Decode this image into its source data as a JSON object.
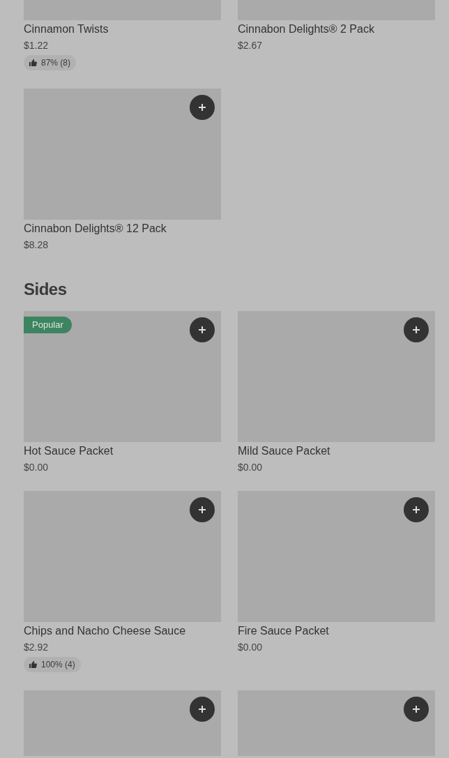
{
  "sections": [
    {
      "items": [
        {
          "kind": "top-cut",
          "name": "Cinnamon Twists",
          "price": "$1.22",
          "rating": "87% (8)"
        },
        {
          "kind": "top-cut",
          "name": "Cinnabon Delights® 2 Pack",
          "price": "$2.67"
        },
        {
          "kind": "full",
          "name": "Cinnabon Delights® 12 Pack",
          "price": "$8.28"
        }
      ]
    },
    {
      "heading": "Sides",
      "items": [
        {
          "kind": "full",
          "badge": "Popular",
          "name": "Hot Sauce Packet",
          "price": "$0.00"
        },
        {
          "kind": "full",
          "name": "Mild Sauce Packet",
          "price": "$0.00"
        },
        {
          "kind": "full",
          "name": "Chips and Nacho Cheese Sauce",
          "price": "$2.92",
          "rating": "100% (4)"
        },
        {
          "kind": "full",
          "name": "Fire Sauce Packet",
          "price": "$0.00"
        },
        {
          "kind": "bottom-cut"
        },
        {
          "kind": "bottom-cut"
        }
      ]
    }
  ]
}
